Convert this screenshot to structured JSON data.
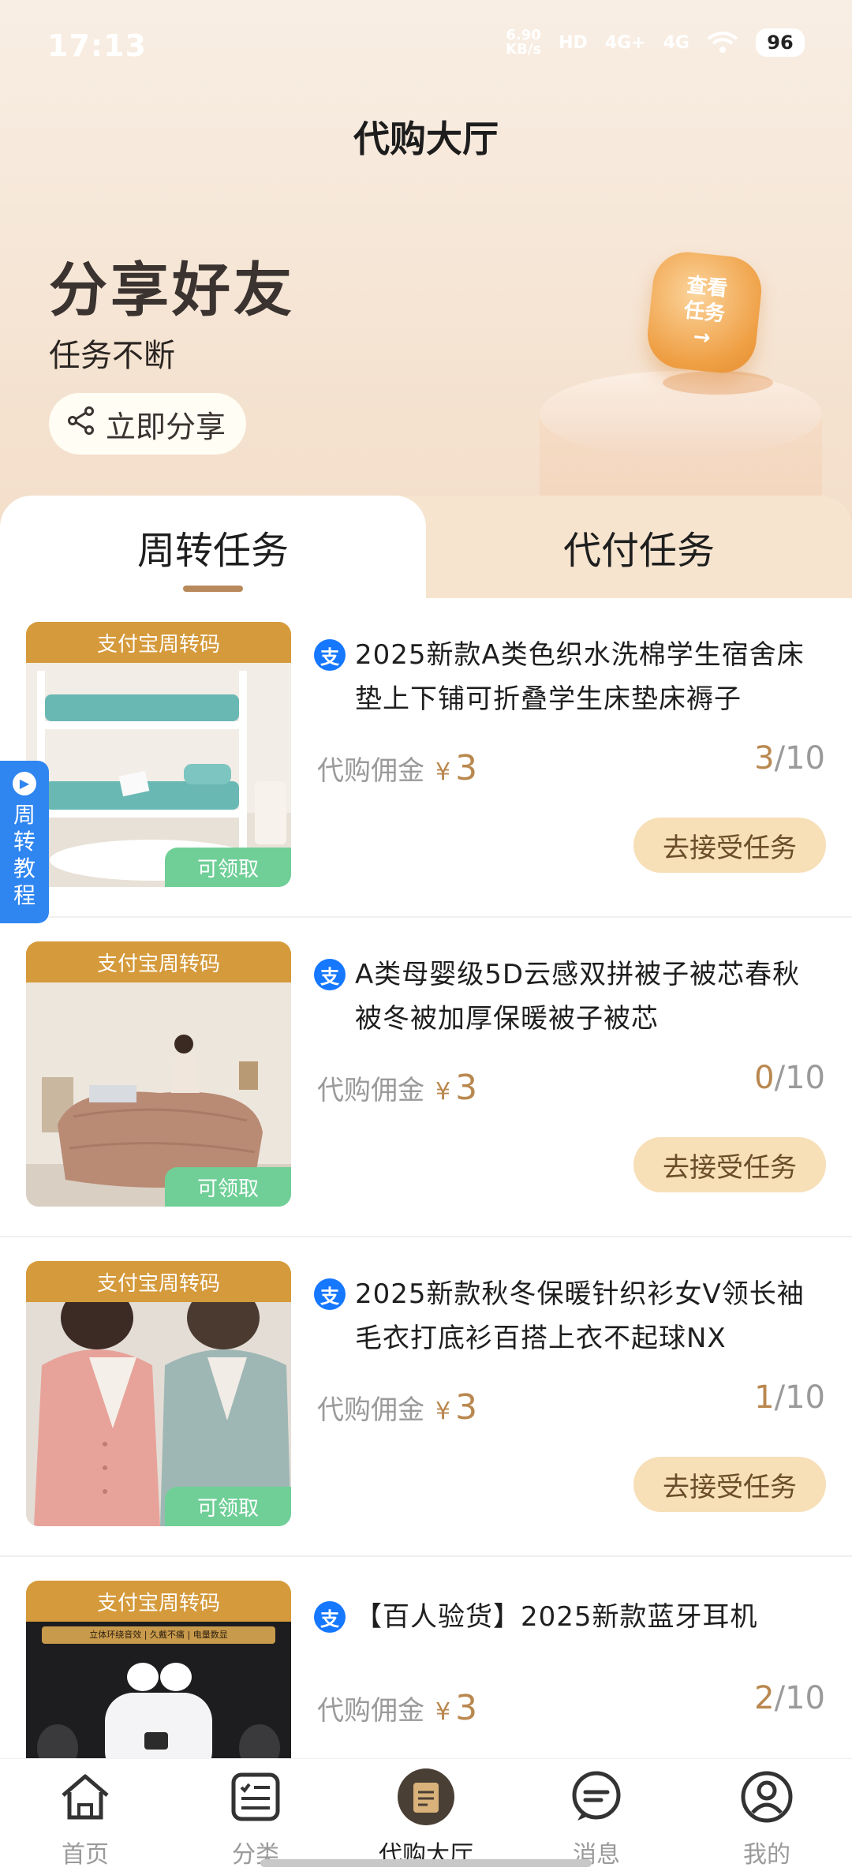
{
  "status_bar": {
    "time": "17:13",
    "net_speed": "6.90",
    "net_unit": "KB/s",
    "hd": "HD",
    "signal_1": "4G+",
    "signal_2": "4G",
    "battery": "96"
  },
  "header": {
    "title": "代购大厅"
  },
  "promo": {
    "title": "分享好友",
    "subtitle": "任务不断",
    "share_button": "立即分享",
    "badge_lines": [
      "查看",
      "任务",
      "→"
    ]
  },
  "tabs": [
    {
      "label": "周转任务",
      "active": true
    },
    {
      "label": "代付任务",
      "active": false
    }
  ],
  "tutorial": {
    "label": "周转教程"
  },
  "items": [
    {
      "tag": "支付宝周转码",
      "claim": "可领取",
      "title": "2025新款A类色织水洗棉学生宿舍床垫上下铺可折叠学生床垫床褥子",
      "commission_label": "代购佣金",
      "currency": "¥",
      "commission": "3",
      "done": "3",
      "total": "/10",
      "button": "去接受任务"
    },
    {
      "tag": "支付宝周转码",
      "claim": "可领取",
      "title": "A类母婴级5D云感双拼被子被芯春秋被冬被加厚保暖被子被芯",
      "commission_label": "代购佣金",
      "currency": "¥",
      "commission": "3",
      "done": "0",
      "total": "/10",
      "button": "去接受任务"
    },
    {
      "tag": "支付宝周转码",
      "claim": "可领取",
      "title": "2025新款秋冬保暖针织衫女V领长袖毛衣打底衫百搭上衣不起球NX",
      "commission_label": "代购佣金",
      "currency": "¥",
      "commission": "3",
      "done": "1",
      "total": "/10",
      "button": "去接受任务"
    },
    {
      "tag": "支付宝周转码",
      "claim": "",
      "title": "【百人验货】2025新款蓝牙耳机",
      "commission_label": "代购佣金",
      "currency": "¥",
      "commission": "3",
      "done": "2",
      "total": "/10",
      "button": "",
      "image_caption": "立体环绕音效 | 久戴不痛 | 电量数显"
    }
  ],
  "bottom_nav": [
    {
      "label": "首页",
      "icon": "home-icon",
      "active": false
    },
    {
      "label": "分类",
      "icon": "category-icon",
      "active": false
    },
    {
      "label": "代购大厅",
      "icon": "purchase-hall-icon",
      "active": true
    },
    {
      "label": "消息",
      "icon": "message-icon",
      "active": false
    },
    {
      "label": "我的",
      "icon": "profile-icon",
      "active": false
    }
  ],
  "colors": {
    "accent": "#b9884f",
    "tag_orange": "#d59a3b",
    "claim_green": "#6fcf97",
    "button_bg": "#f7dfb8",
    "alipay_blue": "#1677ff",
    "tutorial_blue": "#2f86f0"
  }
}
